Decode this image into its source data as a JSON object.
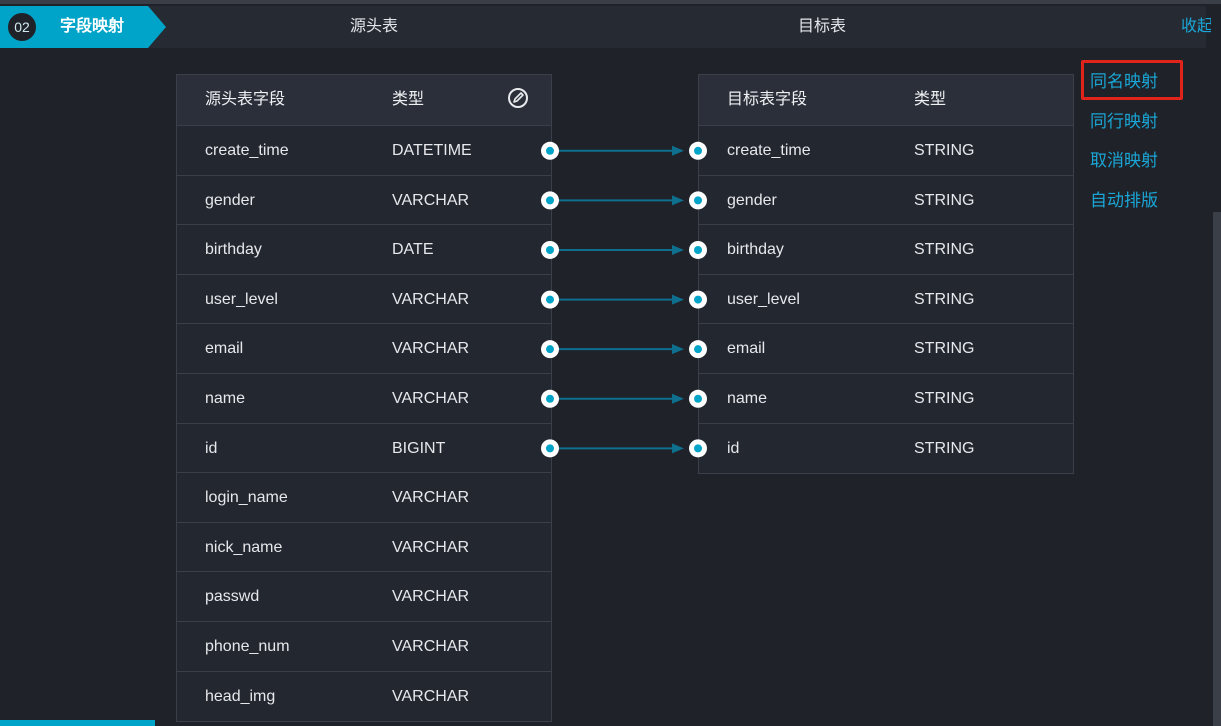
{
  "header": {
    "step_number": "02",
    "step_label": "字段映射",
    "source_title": "源头表",
    "target_title": "目标表",
    "collapse_label": "收起"
  },
  "source_table": {
    "col_field": "源头表字段",
    "col_type": "类型",
    "rows": [
      {
        "field": "create_time",
        "type": "DATETIME"
      },
      {
        "field": "gender",
        "type": "VARCHAR"
      },
      {
        "field": "birthday",
        "type": "DATE"
      },
      {
        "field": "user_level",
        "type": "VARCHAR"
      },
      {
        "field": "email",
        "type": "VARCHAR"
      },
      {
        "field": "name",
        "type": "VARCHAR"
      },
      {
        "field": "id",
        "type": "BIGINT"
      },
      {
        "field": "login_name",
        "type": "VARCHAR"
      },
      {
        "field": "nick_name",
        "type": "VARCHAR"
      },
      {
        "field": "passwd",
        "type": "VARCHAR"
      },
      {
        "field": "phone_num",
        "type": "VARCHAR"
      },
      {
        "field": "head_img",
        "type": "VARCHAR"
      }
    ]
  },
  "target_table": {
    "col_field": "目标表字段",
    "col_type": "类型",
    "rows": [
      {
        "field": "create_time",
        "type": "STRING"
      },
      {
        "field": "gender",
        "type": "STRING"
      },
      {
        "field": "birthday",
        "type": "STRING"
      },
      {
        "field": "user_level",
        "type": "STRING"
      },
      {
        "field": "email",
        "type": "STRING"
      },
      {
        "field": "name",
        "type": "STRING"
      },
      {
        "field": "id",
        "type": "STRING"
      }
    ]
  },
  "actions": {
    "same_name": "同名映射",
    "same_row": "同行映射",
    "cancel": "取消映射",
    "auto_layout": "自动排版"
  },
  "colors": {
    "accent": "#00a4c8",
    "link": "#1aa6d6",
    "highlight": "#e0231b",
    "connector": "#0e6f8f"
  },
  "icons": {
    "edit": "edit-pen-icon"
  }
}
